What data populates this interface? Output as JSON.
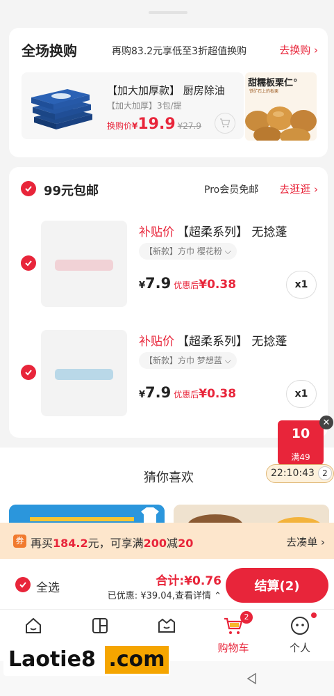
{
  "exchange": {
    "title": "全场换购",
    "desc": "再购83.2元享低至3折超值换购",
    "link": "去换购",
    "item1": {
      "name": "【加大加厚款】 厨房除油",
      "sub": "【加大加厚】3包/提",
      "price_label": "换购价",
      "currency": "¥",
      "price": "19.9",
      "orig_price": "¥27.9"
    },
    "item2": {
      "name": "甜糯板栗仁°",
      "sub": "铁矿石上的板栗"
    }
  },
  "shipping": {
    "title": "99元包邮",
    "pro": "Pro会员免邮",
    "link": "去逛逛",
    "items": [
      {
        "tag": "补贴价",
        "name": "【超柔系列】 无捻蓬",
        "spec": "【新款】方巾 樱花粉",
        "currency": "¥",
        "price": "7.9",
        "after_label": "优惠后",
        "after_price": "¥0.38",
        "qty": "x1",
        "color": "#f1d2d6"
      },
      {
        "tag": "补贴价",
        "name": "【超柔系列】 无捻蓬",
        "spec": "【新款】方巾 梦想蓝",
        "currency": "¥",
        "price": "7.9",
        "after_label": "优惠后",
        "after_price": "¥0.38",
        "qty": "x1",
        "color": "#b9d8e8"
      }
    ]
  },
  "coupon": {
    "amount": "10",
    "condition": "满49",
    "timer": "22:10:43",
    "count": "2"
  },
  "guess": {
    "title": "猜你喜欢"
  },
  "promo": {
    "icon": "券",
    "text_a": "再买",
    "amount": "184.2",
    "text_b": "元，可享满",
    "threshold": "200",
    "text_c": "减",
    "discount": "20",
    "link": "去凑单"
  },
  "checkout": {
    "select_all": "全选",
    "total_label": "合计:",
    "total": "¥0.76",
    "discount_label": "已优惠: ",
    "discount": "¥39.04",
    "detail": ",查看详情",
    "pay": "结算(2)"
  },
  "tabs": [
    {
      "label": ""
    },
    {
      "label": ""
    },
    {
      "label": ""
    },
    {
      "label": "购物车",
      "badge": "2"
    },
    {
      "label": "个人"
    }
  ],
  "watermark": {
    "text": "Laotie8",
    "suffix": ".com"
  },
  "colors": {
    "accent": "#e8253a",
    "promo_bg": "#fde6cc",
    "coupon_bg": "#e8253a"
  }
}
